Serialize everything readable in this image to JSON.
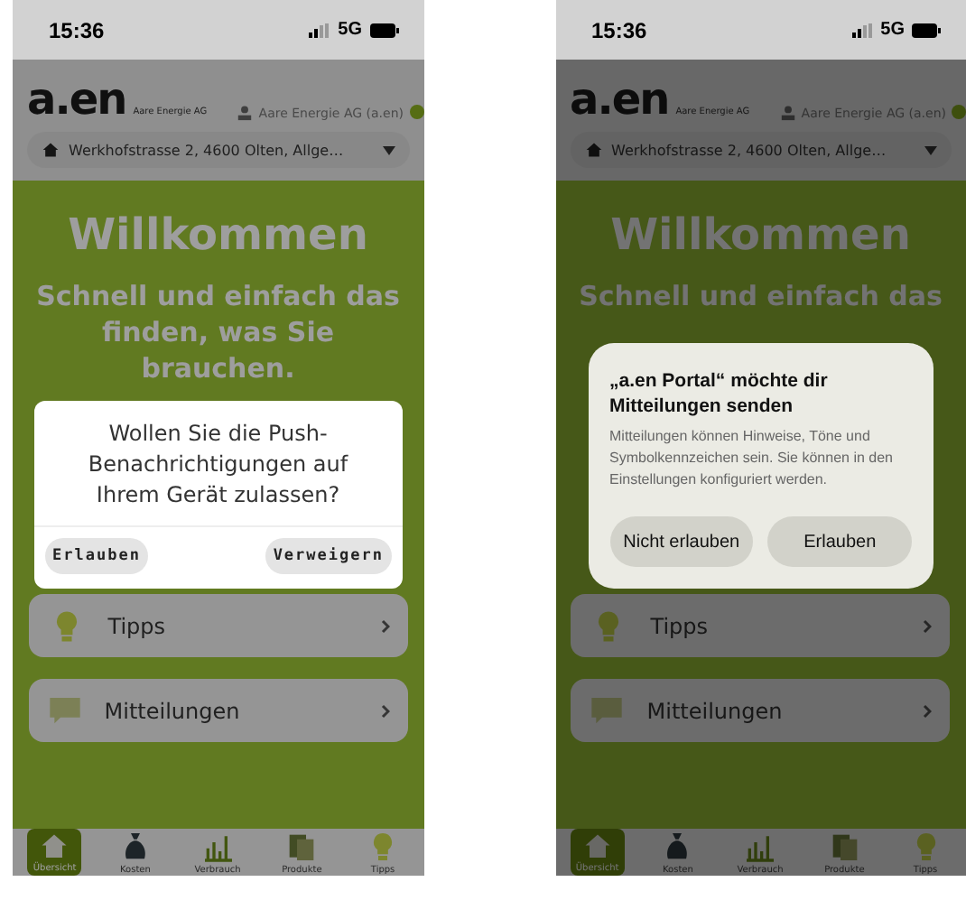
{
  "screens": [
    {
      "status_bar": {
        "time": "15:36",
        "network": "5G"
      },
      "header": {
        "logo": "a.en",
        "company": "Aare Energie AG",
        "account": "Aare Energie AG (a.en)",
        "address": "Werkhofstrasse 2, 4600 Olten, Allge…"
      },
      "welcome": "Willkommen",
      "tagline": [
        "Schnell und einfach das",
        "finden, was Sie",
        "brauchen."
      ],
      "cards": [
        {
          "kind": "tips",
          "label": "Tipps"
        },
        {
          "kind": "messages",
          "label": "Mitteilungen"
        }
      ],
      "tab_bar": [
        {
          "kind": "home",
          "label": "Übersicht",
          "selected": true
        },
        {
          "kind": "costs",
          "label": "Kosten",
          "selected": false
        },
        {
          "kind": "usage",
          "label": "Verbrauch",
          "selected": false
        },
        {
          "kind": "products",
          "label": "Produkte",
          "selected": false
        },
        {
          "kind": "tips",
          "label": "Tipps",
          "selected": false
        }
      ],
      "dialog": {
        "kind": "app",
        "message": "Wollen Sie die Push-Benachrichtigungen auf Ihrem Gerät zulassen?",
        "buttons": [
          "Erlauben",
          "Verweigern"
        ]
      }
    },
    {
      "status_bar": {
        "time": "15:36",
        "network": "5G"
      },
      "header": {
        "logo": "a.en",
        "company": "Aare Energie AG",
        "account": "Aare Energie AG (a.en)",
        "address": "Werkhofstrasse 2, 4600 Olten, Allge…"
      },
      "welcome": "Willkommen",
      "tagline": [
        "Schnell und einfach das"
      ],
      "cards": [
        {
          "kind": "tips",
          "label": "Tipps"
        },
        {
          "kind": "messages",
          "label": "Mitteilungen"
        }
      ],
      "tab_bar": [
        {
          "kind": "home",
          "label": "Übersicht",
          "selected": true
        },
        {
          "kind": "costs",
          "label": "Kosten",
          "selected": false
        },
        {
          "kind": "usage",
          "label": "Verbrauch",
          "selected": false
        },
        {
          "kind": "products",
          "label": "Produkte",
          "selected": false
        },
        {
          "kind": "tips",
          "label": "Tipps",
          "selected": false
        }
      ],
      "dialog": {
        "kind": "system",
        "title": "„a.en Portal“ möchte dir Mitteilungen senden",
        "message": "Mitteilungen können Hinweise, Töne und Symbolkennzeichen sein. Sie können in den Einstellungen konfiguriert werden.",
        "buttons": [
          "Nicht erlauben",
          "Erlauben"
        ]
      }
    }
  ]
}
